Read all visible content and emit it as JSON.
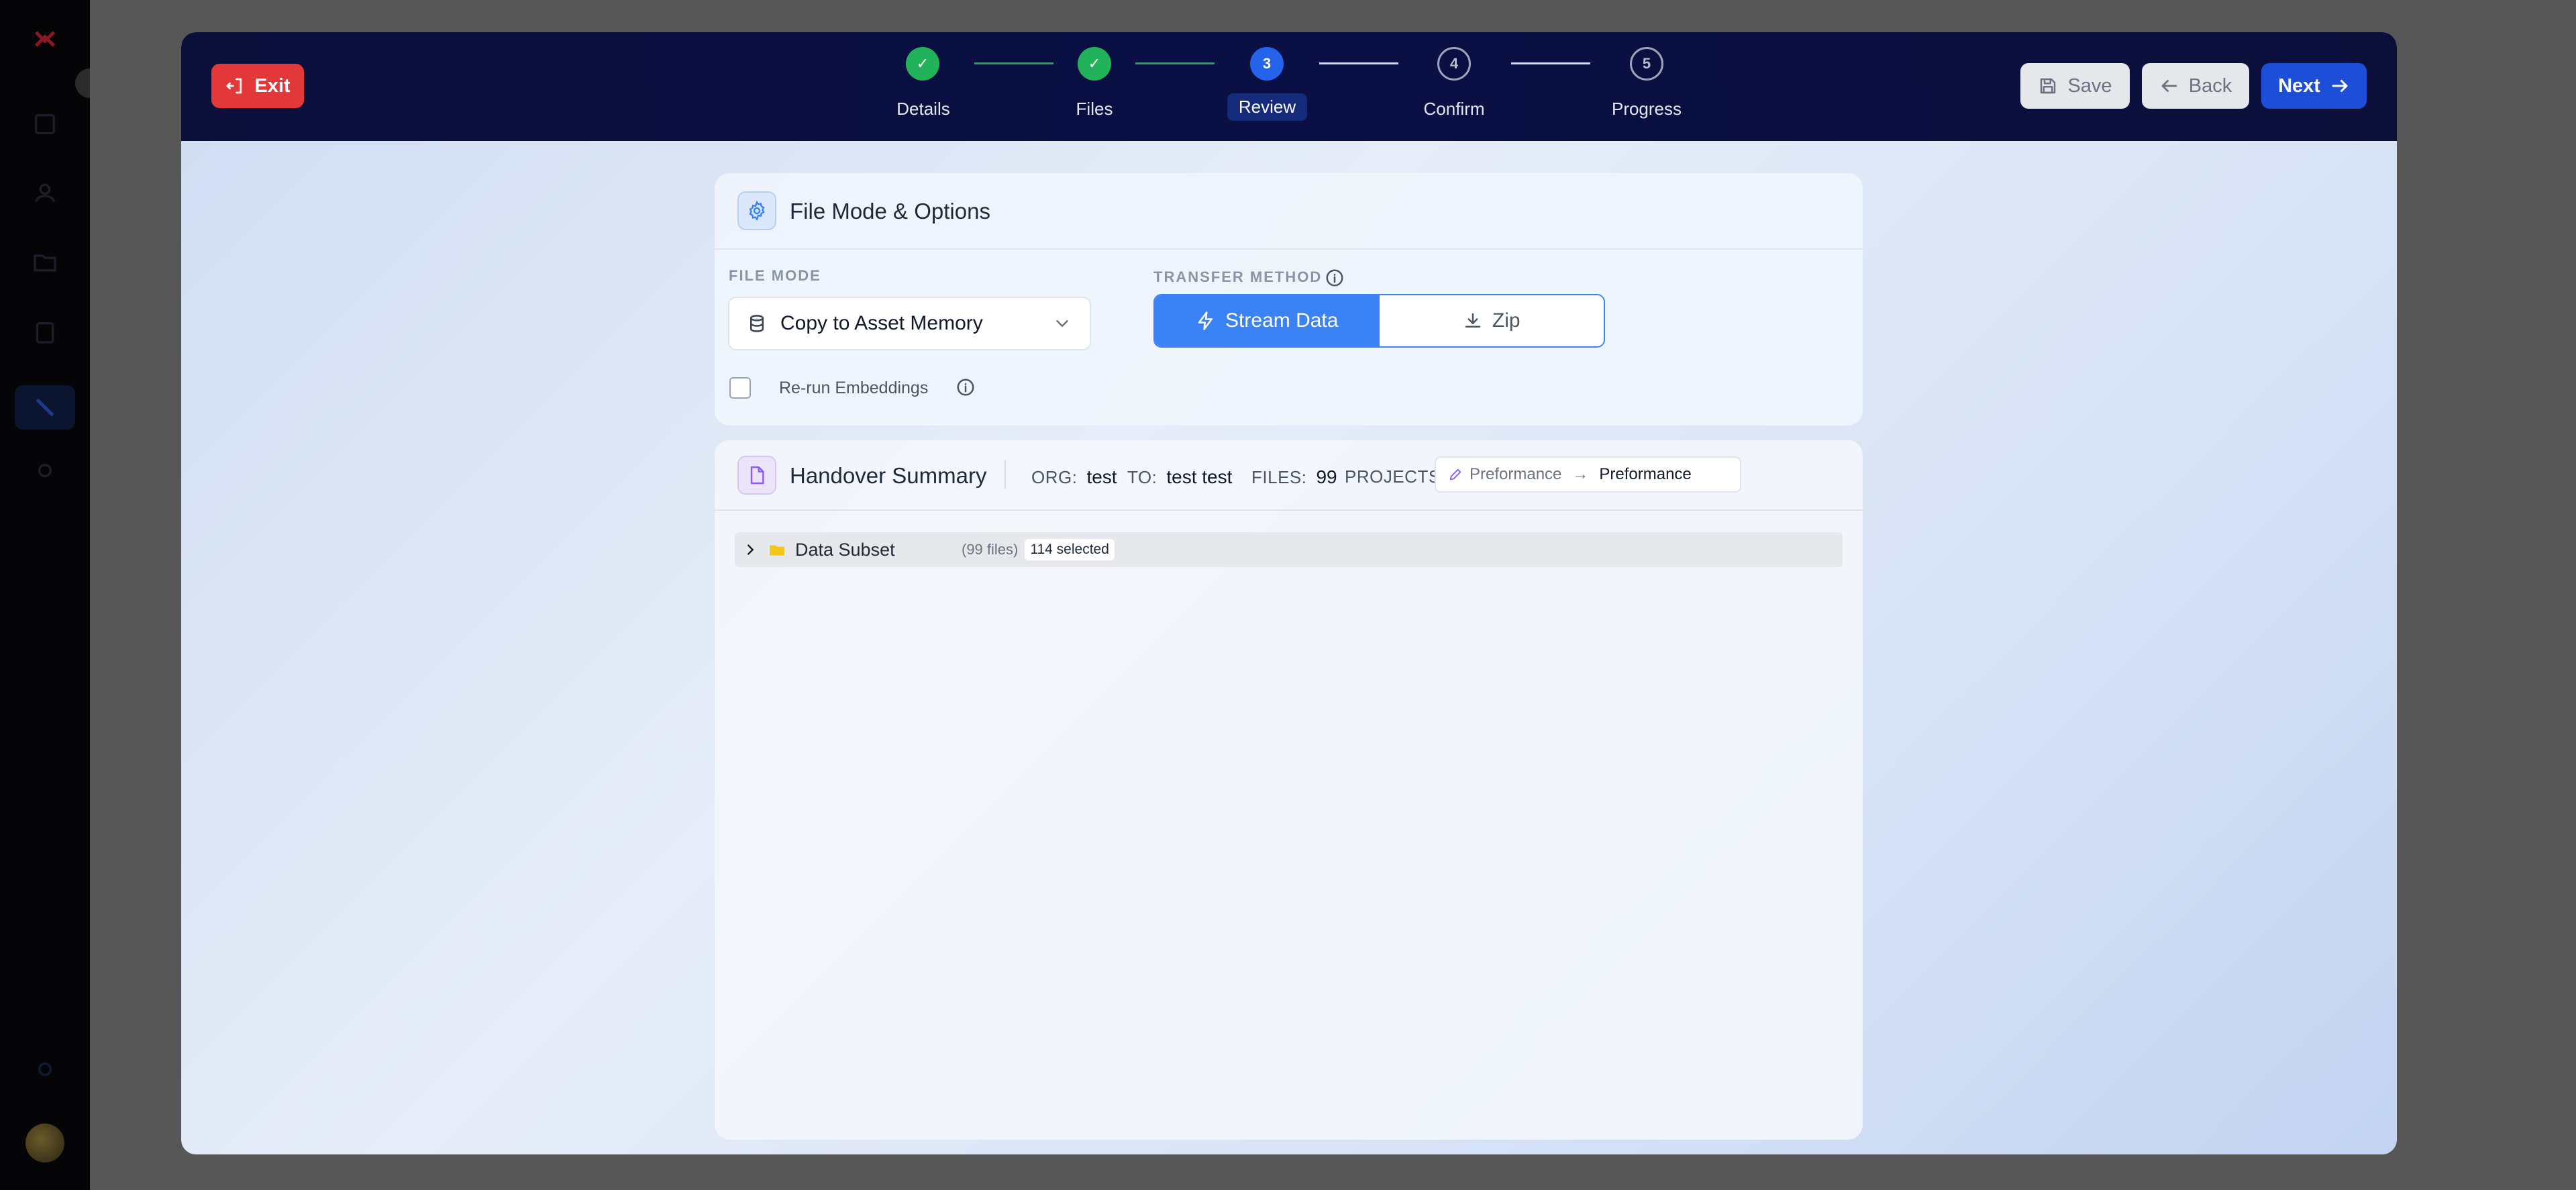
{
  "header": {
    "exit_label": "Exit",
    "save_label": "Save",
    "back_label": "Back",
    "next_label": "Next"
  },
  "stepper": {
    "steps": [
      {
        "label": "Details",
        "marker": "✓",
        "state": "done"
      },
      {
        "label": "Files",
        "marker": "✓",
        "state": "done"
      },
      {
        "label": "Review",
        "marker": "3",
        "state": "current"
      },
      {
        "label": "Confirm",
        "marker": "4",
        "state": "future"
      },
      {
        "label": "Progress",
        "marker": "5",
        "state": "future"
      }
    ]
  },
  "options": {
    "title": "File Mode & Options",
    "file_mode_label": "FILE MODE",
    "file_mode_value": "Copy to Asset Memory",
    "transfer_label": "TRANSFER METHOD",
    "transfer_options": [
      "Stream Data",
      "Zip"
    ],
    "transfer_selected": "Stream Data",
    "rerun_label": "Re-run Embeddings",
    "rerun_checked": false
  },
  "summary": {
    "title": "Handover Summary",
    "org_key": "ORG:",
    "org_value": "test",
    "to_key": "TO:",
    "to_value": "test test",
    "files_key": "FILES:",
    "files_value": "99",
    "projects_key": "PROJECTS:",
    "project_from": "Preformance",
    "project_arrow": "→",
    "project_to": "Preformance",
    "tree": {
      "name": "Data Subset",
      "count": "(99 files)",
      "selected": "114 selected"
    }
  },
  "colors": {
    "header_bg": "#0b0f3a",
    "primary": "#1d4ed8",
    "toggle_active": "#3b82f6",
    "exit": "#e3383a",
    "success": "#22b35a"
  },
  "icons": {
    "exit": "exit-icon",
    "save": "save-icon",
    "back": "arrow-left-icon",
    "next": "arrow-right-icon",
    "options": "gear-icon",
    "file_mode": "database-icon",
    "stream": "lightning-icon",
    "zip": "download-icon",
    "summary": "document-icon",
    "folder": "folder-icon"
  }
}
